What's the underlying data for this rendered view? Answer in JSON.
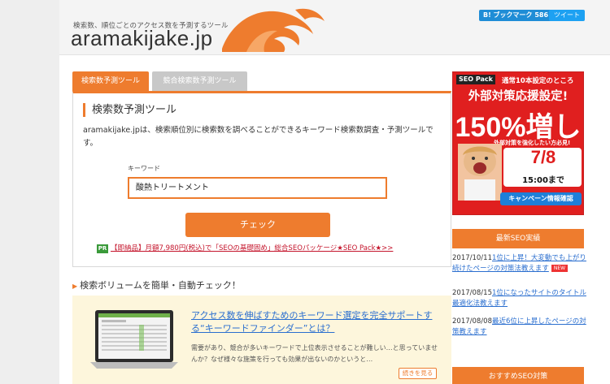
{
  "header": {
    "tagline": "検索数、順位ごとのアクセス数を予測するツール",
    "logo": "aramakijake.jp",
    "hatena_label": "B! ブックマーク 586",
    "twitter_label": "ツイート"
  },
  "tabs": [
    {
      "label": "検索数予測ツール",
      "active": true
    },
    {
      "label": "競合検索数予測ツール",
      "active": false
    }
  ],
  "tool": {
    "title": "検索数予測ツール",
    "description": "aramakijake.jpは、検索順位別に検索数を調べることができるキーワード検索数調査・予測ツールです。",
    "keyword_label": "キーワード",
    "keyword_value": "酸熱トリートメント",
    "check_label": "チェック",
    "pr_badge": "PR",
    "pr_link": "【即納品】月額7,980円(税込)で「SEOの基礎固め」総合SEOパッケージ★SEO Pack★>>"
  },
  "section2": {
    "title": "検索ボリュームを簡単・自動チェック！",
    "feature_title": "アクセス数を伸ばすためのキーワード選定を完全サポートする“キーワードファインダー”とは？",
    "feature_desc": "需要があり、競合が多いキーワードで上位表示させることが難しい…と思っていませんか？なぜ様々な施策を行っても効果が出ないのかというと…",
    "more_label": "続きを見る"
  },
  "ad": {
    "brand": "SEO Pack",
    "top_text": "通常10本設定のところ",
    "headline": "外部対策応援設定!",
    "percent": "150%増し",
    "sub": "外部対策を強化したい方必見!",
    "date": "7/8",
    "time": "15:00まで",
    "cta": "キャンペーン情報確認"
  },
  "sidebar": {
    "heading1": "最新SEO実績",
    "heading2": "おすすめSEO対策",
    "news": [
      {
        "date": "2017/10/11",
        "text": "1位に上昇！大変動でも上がり続けたページの対策法教えます",
        "new_badge": "NEW"
      },
      {
        "date": "2017/08/15",
        "text": "1位になったサイトのタイトル最適化法教えます"
      },
      {
        "date": "2017/08/08",
        "text": "最近6位に上昇したページの対策教えます"
      }
    ]
  },
  "colors": {
    "accent": "#ee7c2e",
    "link": "#2a6ecf",
    "pr_link": "#c4142b",
    "ad_red": "#e01f1f"
  }
}
